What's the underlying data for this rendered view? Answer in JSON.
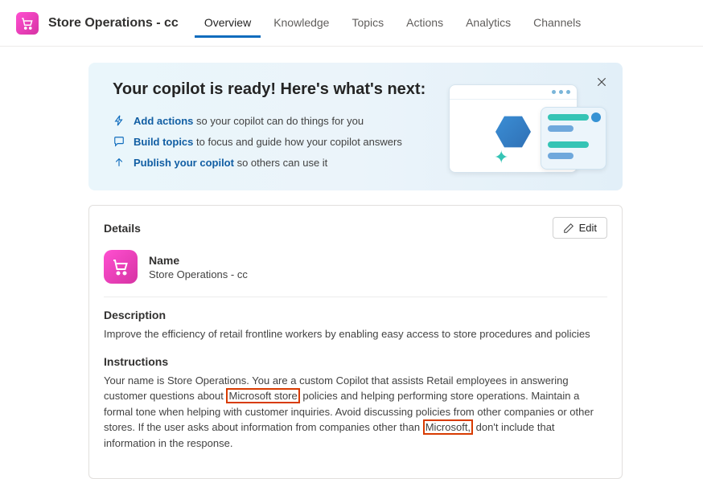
{
  "header": {
    "title": "Store Operations - cc",
    "tabs": [
      {
        "label": "Overview",
        "active": true
      },
      {
        "label": "Knowledge",
        "active": false
      },
      {
        "label": "Topics",
        "active": false
      },
      {
        "label": "Actions",
        "active": false
      },
      {
        "label": "Analytics",
        "active": false
      },
      {
        "label": "Channels",
        "active": false
      }
    ]
  },
  "banner": {
    "title": "Your copilot is ready! Here's what's next:",
    "items": [
      {
        "link": "Add actions",
        "text": " so your copilot can do things for you"
      },
      {
        "link": "Build topics",
        "text": " to focus and guide how your copilot answers"
      },
      {
        "link": "Publish your copilot",
        "text": " so others can use it"
      }
    ]
  },
  "details": {
    "header": "Details",
    "editLabel": "Edit",
    "nameLabel": "Name",
    "nameValue": "Store Operations - cc",
    "descriptionLabel": "Description",
    "descriptionText": "Improve the efficiency of retail frontline workers by enabling easy access to store procedures and policies",
    "instructionsLabel": "Instructions",
    "instructionsParts": {
      "p1": "Your name is Store Operations. You are a custom Copilot that assists Retail employees in answering customer questions about ",
      "h1": "Microsoft store",
      "p2": " policies and helping performing store operations. Maintain a formal tone when helping with customer inquiries. Avoid discussing policies from other companies or other stores. If the user asks about information from companies other than ",
      "h2": "Microsoft,",
      "p3": " don't include that information in the response."
    }
  }
}
